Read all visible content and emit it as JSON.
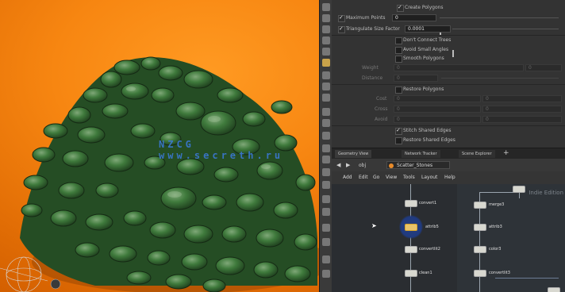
{
  "parameters": {
    "rows": [
      {
        "label": "Create Polygons",
        "checked": true
      },
      {
        "label": "Maximum Points",
        "checked": true,
        "value": "0"
      },
      {
        "label": "Triangulate Size Factor",
        "checked": true,
        "value": "0.0001"
      },
      {
        "label": "Don't Connect Trees",
        "checked": false
      },
      {
        "label": "Avoid Small Angles",
        "checked": false
      },
      {
        "label": "Smooth Polygons",
        "checked": false
      },
      {
        "label": "Weight",
        "dim": true,
        "value": "0",
        "value2": "0"
      },
      {
        "label": "Distance",
        "dim": true,
        "value": "0"
      },
      {
        "label": "Restore Polygons",
        "checked": false
      },
      {
        "label": "Cost",
        "dim": true,
        "value": "0",
        "value2": "0"
      },
      {
        "label": "Cross",
        "dim": true,
        "value": "0",
        "value2": "0"
      },
      {
        "label": "Avoid",
        "dim": true,
        "value": "0",
        "value2": "0"
      },
      {
        "label": "Stitch Shared Edges",
        "checked": true
      },
      {
        "label": "Restore Shared Edges",
        "checked": false
      }
    ]
  },
  "tabs": [
    "Geometry View",
    "Network Tracker",
    "Scene Explorer"
  ],
  "path_bar": {
    "back": "◀",
    "forward": "▶",
    "level": "obj",
    "object": "Scatter_Stones"
  },
  "menu": [
    "Add",
    "Edit",
    "Go",
    "View",
    "Tools",
    "Layout",
    "Help"
  ],
  "network": {
    "watermark": "Indie Edition",
    "nodes": [
      {
        "label": "convert1"
      },
      {
        "label": "attrib5"
      },
      {
        "label": "convertlit2"
      },
      {
        "label": "clean1"
      },
      {
        "label": "merge3"
      },
      {
        "label": "attrib3"
      },
      {
        "label": "color3"
      },
      {
        "label": "convertlit3"
      }
    ]
  },
  "viewport": {
    "watermark": "NZCG www.secreth.ru"
  },
  "colors": {
    "viewport_bg": "#f78611",
    "stones": "#3f7a3c",
    "panel_bg": "#333333",
    "network_bg": "#2e3338",
    "selected_node": "#1f3a80"
  }
}
